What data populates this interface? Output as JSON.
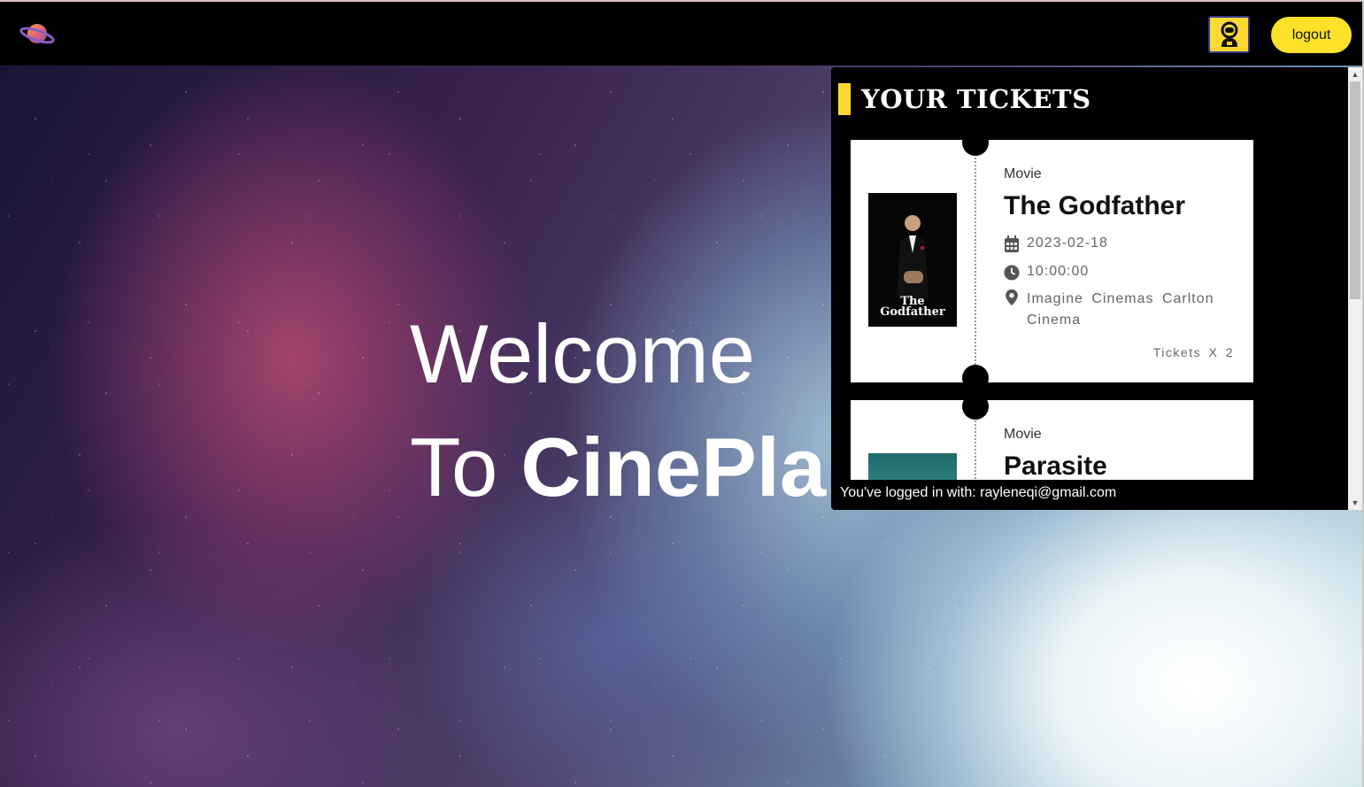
{
  "navbar": {
    "logo_icon": "planet-logo-icon",
    "profile_icon": "astronaut-profile-icon",
    "logout_label": "logout",
    "accent_color": "#fde12b"
  },
  "hero": {
    "line1": "Welcome",
    "line2_prefix": "To ",
    "line2_brand": "CinePla"
  },
  "tickets_panel": {
    "title": "YOUR TICKETS",
    "tickets": [
      {
        "type": "Movie",
        "title": "The Godfather",
        "poster_caption": "The Godfather",
        "date": "2023-02-18",
        "time": "10:00:00",
        "location": "Imagine Cinemas Carlton Cinema",
        "count": "Tickets X 2"
      },
      {
        "type": "Movie",
        "title": "Parasite"
      }
    ],
    "login_note": "You've logged in with: rayleneqi@gmail.com"
  }
}
